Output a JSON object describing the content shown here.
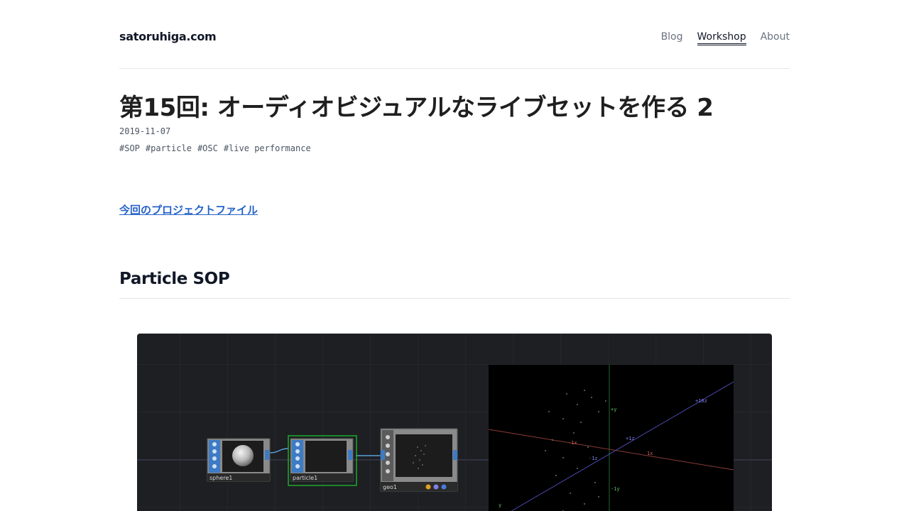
{
  "site": {
    "title": "satoruhiga.com"
  },
  "nav": [
    {
      "label": "Blog",
      "active": false
    },
    {
      "label": "Workshop",
      "active": true
    },
    {
      "label": "About",
      "active": false
    }
  ],
  "post": {
    "title": "第15回: オーディオビジュアルなライブセットを作る 2",
    "date": "2019-11-07",
    "tags": [
      "#SOP",
      "#particle",
      "#OSC",
      "#live performance"
    ],
    "project_link": "今回のプロジェクトファイル",
    "section_heading": "Particle SOP"
  },
  "figure": {
    "nodes": [
      {
        "label": "sphere1"
      },
      {
        "label": "particle1"
      },
      {
        "label": "geo1"
      }
    ],
    "viewport_axis_labels": {
      "y_pos": "+y",
      "y_neg": "-1y",
      "x_pos": "1x",
      "x_neg": "-1x",
      "z_pos": "+1z",
      "z_neg": "-1z",
      "z_far": "+10z",
      "y_bottom": "y"
    }
  }
}
